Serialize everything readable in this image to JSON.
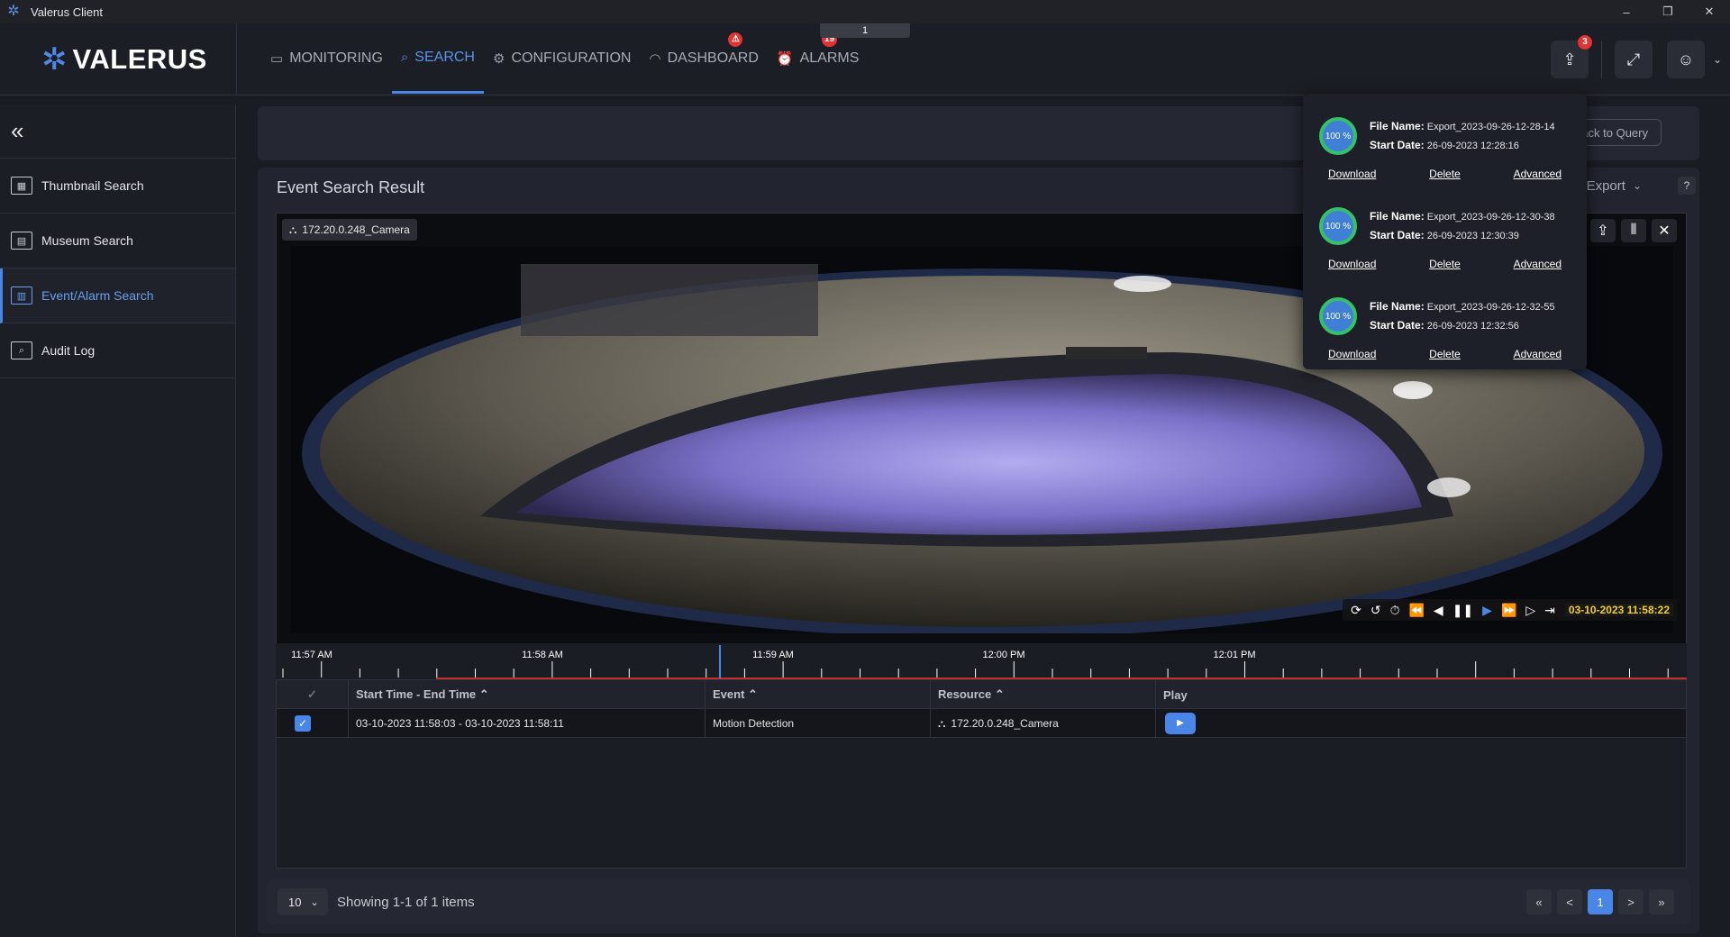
{
  "window": {
    "title": "Valerus Client",
    "controls": [
      "–",
      "❐",
      "✕"
    ]
  },
  "brand": {
    "name": "VALERUS"
  },
  "nav": [
    {
      "label": "MONITORING",
      "icon": "monitor-icon"
    },
    {
      "label": "SEARCH",
      "icon": "search-icon",
      "active": true
    },
    {
      "label": "CONFIGURATION",
      "icon": "configuration-icon"
    },
    {
      "label": "DASHBOARD",
      "icon": "dashboard-icon",
      "badge": "⚠"
    },
    {
      "label": "ALARMS",
      "icon": "alarm-icon",
      "badge": "19"
    }
  ],
  "top_tab": "1",
  "header_right": {
    "export_badge": "3"
  },
  "sidebar": {
    "items": [
      {
        "label": "Thumbnail Search",
        "icon": "thumbnail-grid-icon"
      },
      {
        "label": "Museum Search",
        "icon": "museum-icon"
      },
      {
        "label": "Event/Alarm Search",
        "icon": "event-chart-icon",
        "active": true
      },
      {
        "label": "Audit Log",
        "icon": "audit-log-icon"
      }
    ]
  },
  "query": {
    "back_label": "Back to Query"
  },
  "result": {
    "title": "Event Search Result",
    "export_label": "Export",
    "help": "?"
  },
  "video": {
    "camera": "172.20.0.248_Camera",
    "timestamp": "03-10-2023 11:58:22",
    "timeline_labels": [
      "11:57 AM",
      "11:58 AM",
      "11:59 AM",
      "12:00 PM",
      "12:01 PM"
    ]
  },
  "table": {
    "headers": [
      "Start Time - End Time ⌃",
      "Event ⌃",
      "Resource ⌃",
      "Play"
    ],
    "rows": [
      {
        "time": "03-10-2023 11:58:03  - 03-10-2023 11:58:11",
        "event": "Motion Detection",
        "resource": "172.20.0.248_Camera"
      }
    ]
  },
  "pagination": {
    "page_size": "10",
    "info": "Showing 1-1 of 1 items",
    "current": "1",
    "first": "«",
    "prev": "<",
    "next": ">",
    "last": "»"
  },
  "exports": {
    "file_label": "File Name:",
    "date_label": "Start Date:",
    "actions": [
      "Download",
      "Delete",
      "Advanced"
    ],
    "items": [
      {
        "progress": "100 %",
        "file": "Export_2023-09-26-12-28-14",
        "date": "26-09-2023 12:28:16"
      },
      {
        "progress": "100 %",
        "file": "Export_2023-09-26-12-30-38",
        "date": "26-09-2023 12:30:39"
      },
      {
        "progress": "100 %",
        "file": "Export_2023-09-26-12-32-55",
        "date": "26-09-2023 12:32:56"
      }
    ]
  },
  "colors": {
    "accent": "#4a86e8",
    "badge": "#e03434",
    "timestamp": "#f0d020",
    "progress_ring": "#37c06a"
  }
}
